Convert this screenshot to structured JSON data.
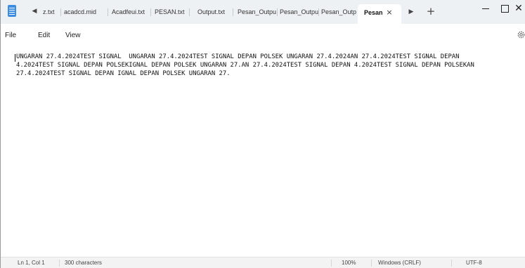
{
  "window": {
    "tabs": [
      {
        "label": "z.txt"
      },
      {
        "label": "acadcd.mid"
      },
      {
        "label": "Acadfeui.txt"
      },
      {
        "label": "PESAN.txt"
      },
      {
        "label": "Output.txt"
      },
      {
        "label": "Pesan_Outpu"
      },
      {
        "label": "Pesan_Outpu"
      },
      {
        "label": "Pesan_Outpu"
      }
    ],
    "active_tab": {
      "label": "Pesan",
      "close": "×"
    },
    "scroll_left": "◀",
    "scroll_right": "▶",
    "new_tab": "+",
    "close_glyph": "✕"
  },
  "menu": {
    "file": "File",
    "edit": "Edit",
    "view": "View"
  },
  "editor": {
    "lines": [
      "UNGARAN 27.4.2024TEST SIGNAL  UNGARAN 27.4.2024TEST SIGNAL DEPAN POLSEK UNGARAN 27.4.2024AN 27.4.2024TEST SIGNAL DEPAN",
      "4.2024TEST SIGNAL DEPAN POLSEKIGNAL DEPAN POLSEK UNGARAN 27.AN 27.4.2024TEST SIGNAL DEPAN 4.2024TEST SIGNAL DEPAN POLSEKAN",
      "27.4.2024TEST SIGNAL DEPAN IGNAL DEPAN POLSEK UNGARAN 27."
    ]
  },
  "status": {
    "position": "Ln 1, Col 1",
    "characters": "300 characters",
    "zoom": "100%",
    "line_ending": "Windows (CRLF)",
    "encoding": "UTF-8"
  },
  "icons": {
    "app": "notepad-icon",
    "settings": "gear-icon"
  },
  "colors": {
    "titlebar": "#eef1f4",
    "accent": "#3d8ee0"
  }
}
